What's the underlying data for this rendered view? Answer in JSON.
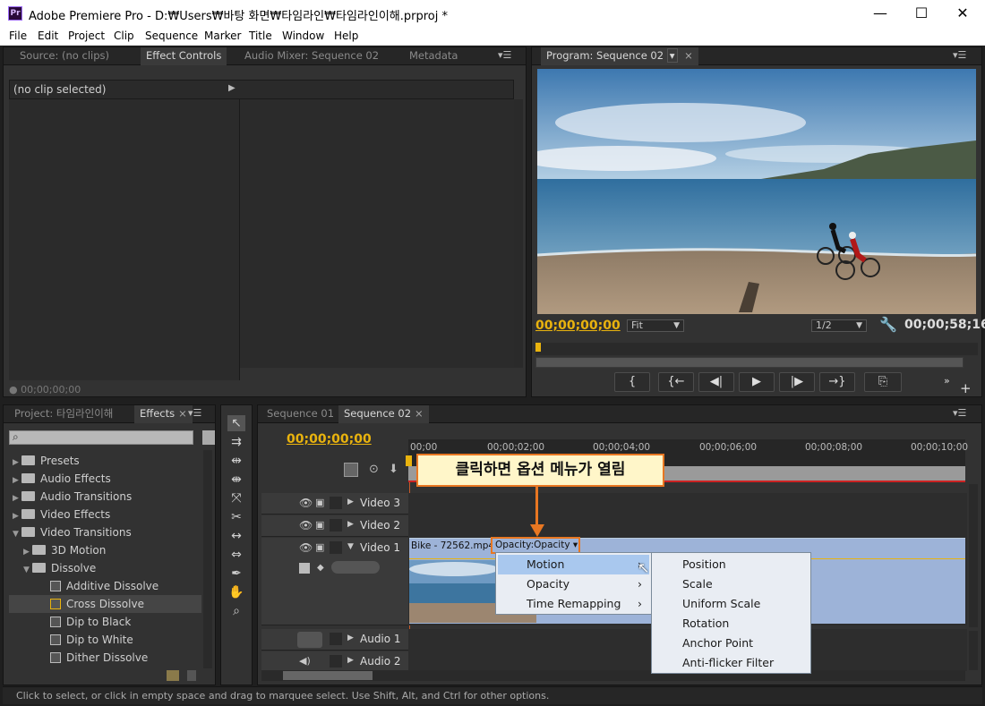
{
  "window": {
    "title": "Adobe Premiere Pro - D:₩Users₩바탕 화면₩타임라인₩타임라인이해.prproj *",
    "app_icon": "Pr",
    "minimize": "—",
    "maximize": "☐",
    "close": "✕"
  },
  "menu": [
    "File",
    "Edit",
    "Project",
    "Clip",
    "Sequence",
    "Marker",
    "Title",
    "Window",
    "Help"
  ],
  "source_panel": {
    "tabs": [
      "Source: (no clips)",
      "Effect Controls",
      "Audio Mixer: Sequence 02",
      "Metadata"
    ],
    "active_tab": "Effect Controls",
    "no_clip": "(no clip selected)",
    "timecode": "00;00;00;00"
  },
  "program_monitor": {
    "tab": "Program: Sequence 02",
    "timecode_current": "00;00;00;00",
    "fit": "Fit",
    "resolution": "1/2",
    "timecode_duration": "00;00;58;16",
    "controls": [
      "{ ",
      "{←",
      "◀|",
      "▶",
      "|▶",
      "→}",
      "⎘"
    ]
  },
  "project_panel": {
    "tabs": [
      "Project: 타임라인이해",
      "Effects"
    ],
    "active_tab": "Effects",
    "tree": [
      {
        "label": "Presets",
        "level": 0,
        "type": "folder-star",
        "expanded": false
      },
      {
        "label": "Audio Effects",
        "level": 0,
        "type": "folder",
        "expanded": false
      },
      {
        "label": "Audio Transitions",
        "level": 0,
        "type": "folder",
        "expanded": false
      },
      {
        "label": "Video Effects",
        "level": 0,
        "type": "folder",
        "expanded": false
      },
      {
        "label": "Video Transitions",
        "level": 0,
        "type": "folder",
        "expanded": true
      },
      {
        "label": "3D Motion",
        "level": 1,
        "type": "folder",
        "expanded": false
      },
      {
        "label": "Dissolve",
        "level": 1,
        "type": "folder",
        "expanded": true
      },
      {
        "label": "Additive Dissolve",
        "level": 2,
        "type": "effect"
      },
      {
        "label": "Cross Dissolve",
        "level": 2,
        "type": "effect",
        "selected": true
      },
      {
        "label": "Dip to Black",
        "level": 2,
        "type": "effect"
      },
      {
        "label": "Dip to White",
        "level": 2,
        "type": "effect"
      },
      {
        "label": "Dither Dissolve",
        "level": 2,
        "type": "effect"
      }
    ]
  },
  "timeline": {
    "tabs": [
      "Sequence 01",
      "Sequence 02"
    ],
    "active_tab": "Sequence 02",
    "timecode": "00;00;00;00",
    "ruler": [
      "00;00",
      "00;00;02;00",
      "00;00;04;00",
      "00;00;06;00",
      "00;00;08;00",
      "00;00;10;00"
    ],
    "tracks": {
      "video3": "Video 3",
      "video2": "Video 2",
      "video1": "Video 1",
      "audio1": "Audio 1",
      "audio2": "Audio 2"
    },
    "clip_name": "Bike - 72562.mp4",
    "opacity_dropdown": "Opacity:Opacity ▾",
    "callout": "클릭하면 옵션 메뉴가 열림",
    "context_menu": [
      "Motion",
      "Opacity",
      "Time Remapping"
    ],
    "submenu": [
      "Position",
      "Scale",
      "Uniform Scale",
      "Rotation",
      "Anchor Point",
      "Anti-flicker Filter"
    ]
  },
  "status_bar": "Click to select, or click in empty space and drag to marquee select. Use Shift, Alt, and Ctrl for other options.",
  "colors": {
    "timecode": "#e9b30e",
    "callout_border": "#e87722",
    "callout_bg": "#fff6c9",
    "clip": "#9db3d8",
    "highlight": "#a9c8ee"
  }
}
